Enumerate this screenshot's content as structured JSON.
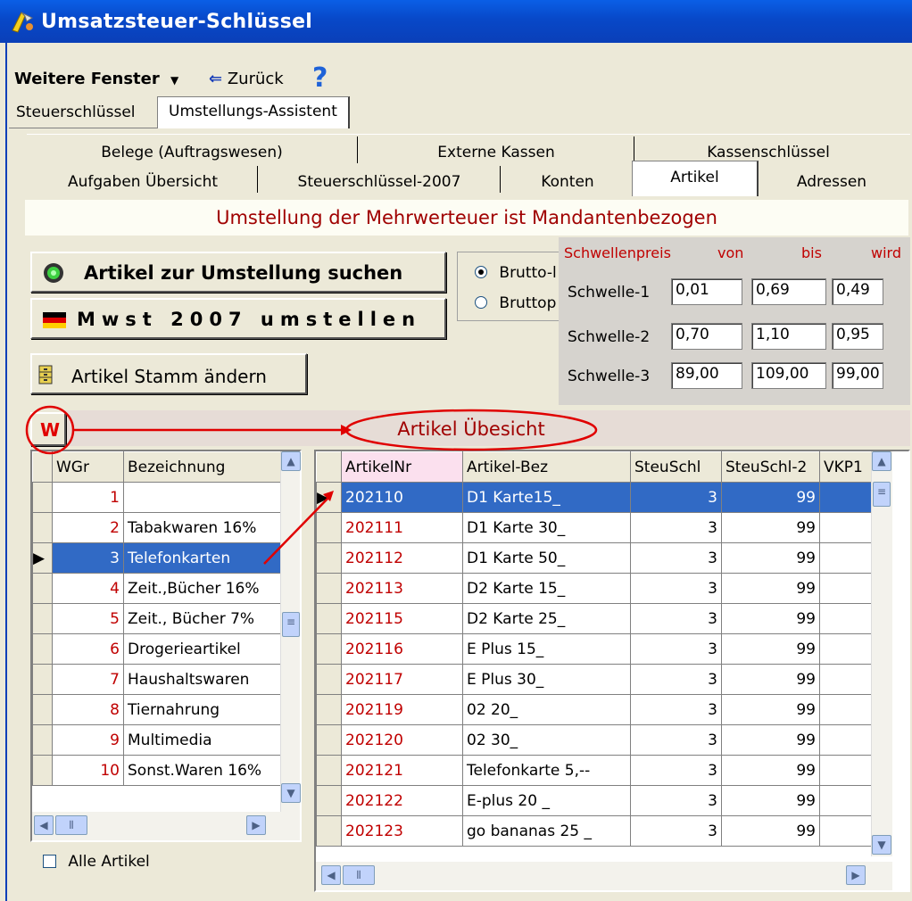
{
  "window": {
    "title": "Umsatzsteuer-Schlüssel"
  },
  "nav": {
    "weitere_fenster": "Weitere Fenster",
    "back": "Zurück",
    "help": "?"
  },
  "top_tabs": [
    "Steuerschlüssel",
    "Umstellungs-Assistent"
  ],
  "tabs_row1": [
    "Belege (Auftragswesen)",
    "Externe Kassen",
    "Kassenschlüssel"
  ],
  "tabs_row2": [
    "Aufgaben Übersicht",
    "Steuerschlüssel-2007",
    "Konten",
    "Artikel",
    "Adressen"
  ],
  "banner": "Umstellung der Mehrwerteuer ist Mandantenbezogen",
  "buttons": {
    "search": "Artikel zur Umstellung suchen",
    "mwst": "Mwst 2007 umstellen",
    "stamm": "Artikel Stamm ändern",
    "w": "W"
  },
  "radios": [
    "Brutto-l",
    "Bruttop"
  ],
  "threshold": {
    "header": "Schwellenpreis",
    "col_von": "von",
    "col_bis": "bis",
    "col_wird": "wird",
    "rows": [
      {
        "label": "Schwelle-1",
        "von": "0,01",
        "bis": "0,69",
        "wird": "0,49"
      },
      {
        "label": "Schwelle-2",
        "von": "0,70",
        "bis": "1,10",
        "wird": "0,95"
      },
      {
        "label": "Schwelle-3",
        "von": "89,00",
        "bis": "109,00",
        "wird": "99,00"
      }
    ]
  },
  "overview_label": "Artikel Übesicht",
  "groups": {
    "headers": [
      "WGr",
      "Bezeichnung"
    ],
    "rows": [
      {
        "id": "1",
        "name": ""
      },
      {
        "id": "2",
        "name": "Tabakwaren 16%"
      },
      {
        "id": "3",
        "name": "Telefonkarten"
      },
      {
        "id": "4",
        "name": "Zeit.,Bücher 16%"
      },
      {
        "id": "5",
        "name": "Zeit., Bücher 7%"
      },
      {
        "id": "6",
        "name": "Drogerieartikel"
      },
      {
        "id": "7",
        "name": "Haushaltswaren"
      },
      {
        "id": "8",
        "name": "Tiernahrung"
      },
      {
        "id": "9",
        "name": "Multimedia"
      },
      {
        "id": "10",
        "name": "Sonst.Waren 16%"
      }
    ]
  },
  "alle_artikel": "Alle Artikel",
  "articles": {
    "headers": [
      "ArtikelNr",
      "Artikel-Bez",
      "SteuSchl",
      "SteuSchl-2",
      "VKP1"
    ],
    "rows": [
      {
        "nr": "202110",
        "bez": "D1 Karte15_",
        "s1": "3",
        "s2": "99"
      },
      {
        "nr": "202111",
        "bez": "D1 Karte 30_",
        "s1": "3",
        "s2": "99"
      },
      {
        "nr": "202112",
        "bez": "D1 Karte 50_",
        "s1": "3",
        "s2": "99"
      },
      {
        "nr": "202113",
        "bez": "D2 Karte 15_",
        "s1": "3",
        "s2": "99"
      },
      {
        "nr": "202115",
        "bez": "D2 Karte 25_",
        "s1": "3",
        "s2": "99"
      },
      {
        "nr": "202116",
        "bez": "E Plus 15_",
        "s1": "3",
        "s2": "99"
      },
      {
        "nr": "202117",
        "bez": "E Plus 30_",
        "s1": "3",
        "s2": "99"
      },
      {
        "nr": "202119",
        "bez": "02 20_",
        "s1": "3",
        "s2": "99"
      },
      {
        "nr": "202120",
        "bez": "02 30_",
        "s1": "3",
        "s2": "99"
      },
      {
        "nr": "202121",
        "bez": "Telefonkarte 5,--",
        "s1": "3",
        "s2": "99"
      },
      {
        "nr": "202122",
        "bez": "E-plus 20 _",
        "s1": "3",
        "s2": "99"
      },
      {
        "nr": "202123",
        "bez": "go bananas 25 _",
        "s1": "3",
        "s2": "99"
      }
    ]
  },
  "colors": {
    "selection": "#316ac5",
    "annotation": "#e00000",
    "title": "#0a4fd8"
  }
}
